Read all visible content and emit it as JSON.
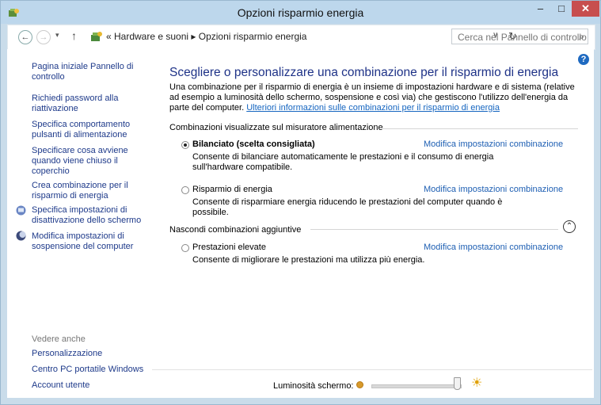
{
  "window": {
    "title": "Opzioni risparmio energia",
    "minimize_glyph": "–",
    "maximize_glyph": "□",
    "close_glyph": "✕"
  },
  "nav": {
    "back_glyph": "←",
    "forward_glyph": "→",
    "recent_glyph": "▾",
    "up_glyph": "↑",
    "address_text": "« Hardware e suoni  ▸  Opzioni risparmio energia",
    "address_dropdown_glyph": "∨",
    "refresh_glyph": "↻",
    "search_placeholder": "Cerca nel Pannello di controllo",
    "search_glyph": "⌕"
  },
  "sidebar": {
    "links": [
      "Pagina iniziale Pannello di controllo",
      "Richiedi password alla riattivazione",
      "Specifica comportamento pulsanti di alimentazione",
      "Specificare cosa avviene quando viene chiuso il coperchio",
      "Crea combinazione per il risparmio di energia",
      "Specifica impostazioni di disattivazione dello schermo",
      "Modifica impostazioni di sospensione del computer"
    ],
    "see_also_label": "Vedere anche",
    "see_also": [
      "Personalizzazione",
      "Centro PC portatile Windows",
      "Account utente"
    ]
  },
  "main": {
    "help_glyph": "?",
    "heading": "Scegliere o personalizzare una combinazione per il risparmio di energia",
    "intro_text": "Una combinazione per il risparmio di energia è un insieme di impostazioni hardware e di sistema (relative ad esempio a luminosità dello schermo, sospensione e così via) che gestiscono l'utilizzo dell'energia da parte del computer. ",
    "intro_link": "Ulteriori informazioni sulle combinazioni per il risparmio di energia",
    "section_visible": "Combinazioni visualizzate sul misuratore alimentazione",
    "section_hidden": "Nascondi combinazioni aggiuntive",
    "collapse_glyph": "⌃",
    "change_link": "Modifica impostazioni combinazione",
    "plans": [
      {
        "name": "Bilanciato (scelta consigliata)",
        "selected": true,
        "description": "Consente di bilanciare automaticamente le prestazioni e il consumo di energia sull'hardware compatibile."
      },
      {
        "name": "Risparmio di energia",
        "selected": false,
        "description": "Consente di risparmiare energia riducendo le prestazioni del computer quando è possibile."
      },
      {
        "name": "Prestazioni elevate",
        "selected": false,
        "description": "Consente di migliorare le prestazioni ma utilizza più energia."
      }
    ]
  },
  "brightness": {
    "label": "Luminosità schermo:",
    "level_fraction": 0.95,
    "sun_glyph": "☀"
  },
  "colors": {
    "link": "#1e3a8a",
    "heading": "#1e3287",
    "close_button": "#c74e4e",
    "titlebar": "#bdd7ec"
  }
}
